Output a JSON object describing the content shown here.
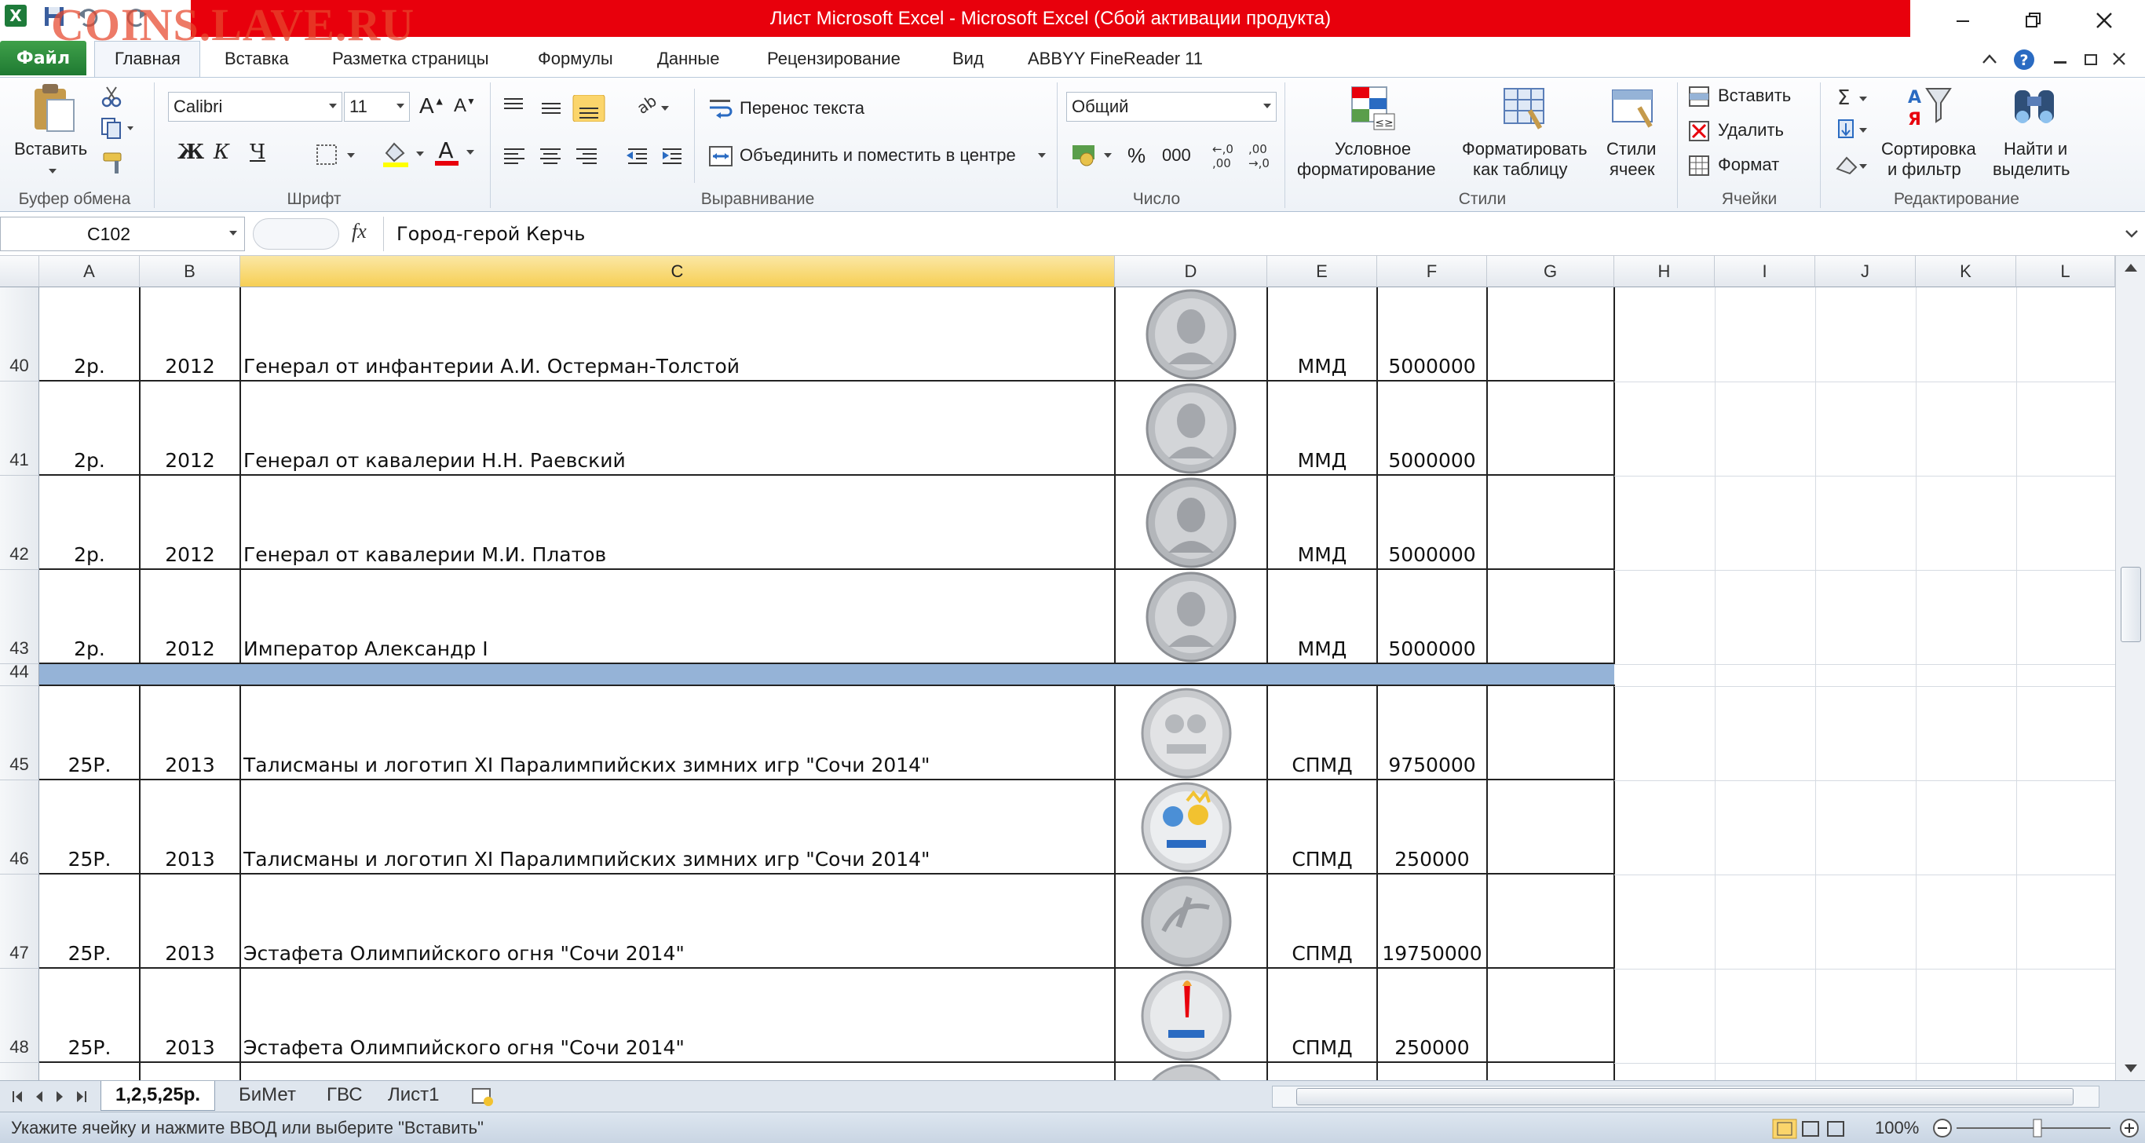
{
  "window": {
    "title": "Лист Microsoft Excel  -  Microsoft Excel (Сбой активации продукта)",
    "watermark": "COINS.LAVE.RU",
    "accent_color": "#e8000c"
  },
  "ribbon_tabs": [
    {
      "label": "Файл"
    },
    {
      "label": "Главная"
    },
    {
      "label": "Вставка"
    },
    {
      "label": "Разметка страницы"
    },
    {
      "label": "Формулы"
    },
    {
      "label": "Данные"
    },
    {
      "label": "Рецензирование"
    },
    {
      "label": "Вид"
    },
    {
      "label": "ABBYY FineReader 11"
    }
  ],
  "ribbon": {
    "clipboard": {
      "paste_label": "Вставить",
      "group_label": "Буфер обмена"
    },
    "font": {
      "font_name": "Calibri",
      "font_size": "11",
      "bold": "Ж",
      "italic": "К",
      "underline": "Ч",
      "group_label": "Шрифт"
    },
    "alignment": {
      "wrap_label": "Перенос текста",
      "merge_label": "Объединить и поместить в центре",
      "group_label": "Выравнивание"
    },
    "number": {
      "format": "Общий",
      "percent": "%",
      "thousands": "000",
      "group_label": "Число"
    },
    "styles": {
      "conditional_1": "Условное",
      "conditional_2": "форматирование",
      "table_1": "Форматировать",
      "table_2": "как таблицу",
      "cell_1": "Стили",
      "cell_2": "ячеек",
      "group_label": "Стили"
    },
    "cells": {
      "insert": "Вставить",
      "delete": "Удалить",
      "format": "Формат",
      "group_label": "Ячейки"
    },
    "editing": {
      "sort_1": "Сортировка",
      "sort_2": "и фильтр",
      "find_1": "Найти и",
      "find_2": "выделить",
      "group_label": "Редактирование"
    }
  },
  "formula_bar": {
    "name_box": "C102",
    "fx": "fx",
    "formula": "Город-герой Керчь"
  },
  "columns": [
    "A",
    "B",
    "C",
    "D",
    "E",
    "F",
    "G",
    "H",
    "I",
    "J",
    "K",
    "L"
  ],
  "rows": [
    {
      "num": "40",
      "a": "2р.",
      "b": "2012",
      "c": "Генерал от инфантерии А.И. Остерман-Толстой",
      "e": "ММД",
      "f": "5000000"
    },
    {
      "num": "41",
      "a": "2р.",
      "b": "2012",
      "c": "Генерал от кавалерии Н.Н. Раевский",
      "e": "ММД",
      "f": "5000000"
    },
    {
      "num": "42",
      "a": "2р.",
      "b": "2012",
      "c": "Генерал от кавалерии М.И. Платов",
      "e": "ММД",
      "f": "5000000"
    },
    {
      "num": "43",
      "a": "2р.",
      "b": "2012",
      "c": "Император Александр I",
      "e": "ММД",
      "f": "5000000"
    },
    {
      "num": "44",
      "a": "",
      "b": "",
      "c": "",
      "e": "",
      "f": ""
    },
    {
      "num": "45",
      "a": "25Р.",
      "b": "2013",
      "c": "Талисманы и логотип XI Паралимпийских зимних игр \"Сочи 2014\"",
      "e": "СПМД",
      "f": "9750000"
    },
    {
      "num": "46",
      "a": "25Р.",
      "b": "2013",
      "c": "Талисманы и логотип XI Паралимпийских зимних игр \"Сочи 2014\"",
      "e": "СПМД",
      "f": "250000"
    },
    {
      "num": "47",
      "a": "25Р.",
      "b": "2013",
      "c": "Эстафета Олимпийского огня \"Сочи 2014\"",
      "e": "СПМД",
      "f": "19750000"
    },
    {
      "num": "48",
      "a": "25Р.",
      "b": "2013",
      "c": "Эстафета Олимпийского огня \"Сочи 2014\"",
      "e": "СПМД",
      "f": "250000"
    }
  ],
  "separator_row_color": "#95b3d7",
  "sheet_tabs": [
    {
      "label": "1,2,5,25р."
    },
    {
      "label": "БиМет"
    },
    {
      "label": "ГВС"
    },
    {
      "label": "Лист1"
    }
  ],
  "status": {
    "text": "Укажите ячейку и нажмите ВВОД или выберите \"Вставить\"",
    "zoom": "100%"
  }
}
